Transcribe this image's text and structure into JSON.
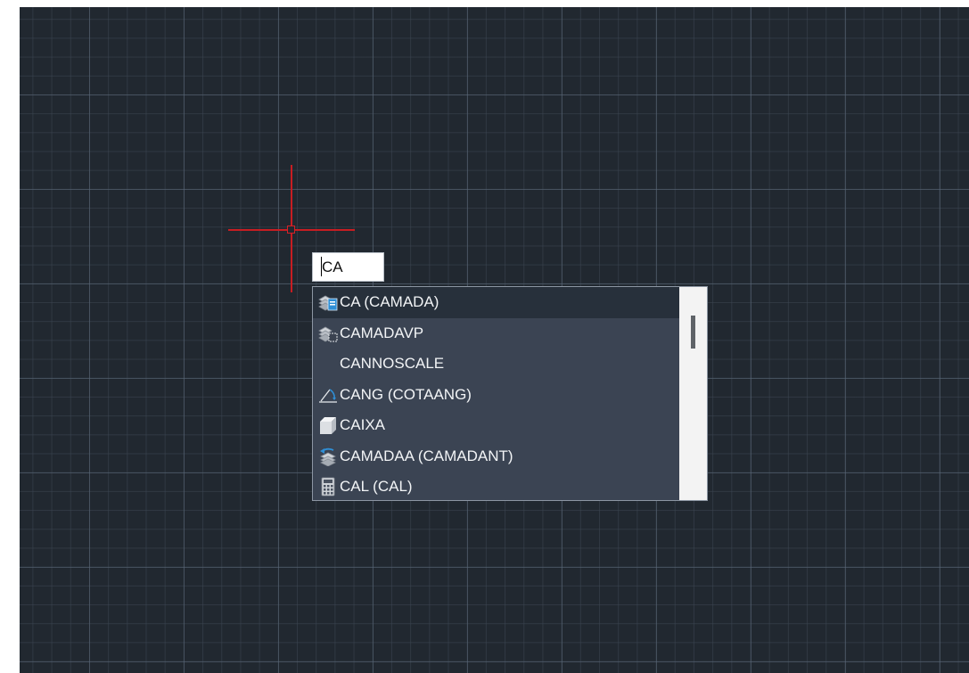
{
  "command_line": {
    "input_value": "CA"
  },
  "autocomplete": {
    "items": [
      {
        "label": "CA (CAMADA)",
        "icon": "layer-properties-icon",
        "selected": true
      },
      {
        "label": "CAMADAVP",
        "icon": "layer-viewport-icon",
        "selected": false
      },
      {
        "label": "CANNOSCALE",
        "icon": "",
        "selected": false
      },
      {
        "label": "CANG (COTAANG)",
        "icon": "angular-dimension-icon",
        "selected": false
      },
      {
        "label": "CAIXA",
        "icon": "box-solid-icon",
        "selected": false
      },
      {
        "label": "CAMADAA (CAMADANT)",
        "icon": "layer-previous-icon",
        "selected": false
      },
      {
        "label": "CAL (CAL)",
        "icon": "calculator-icon",
        "selected": false
      }
    ]
  },
  "colors": {
    "canvas_background": "#212830",
    "crosshair": "#c81d22",
    "dropdown_background": "#3b4453",
    "dropdown_selected": "#27303b",
    "scrollbar_track": "#f3f3f3"
  }
}
